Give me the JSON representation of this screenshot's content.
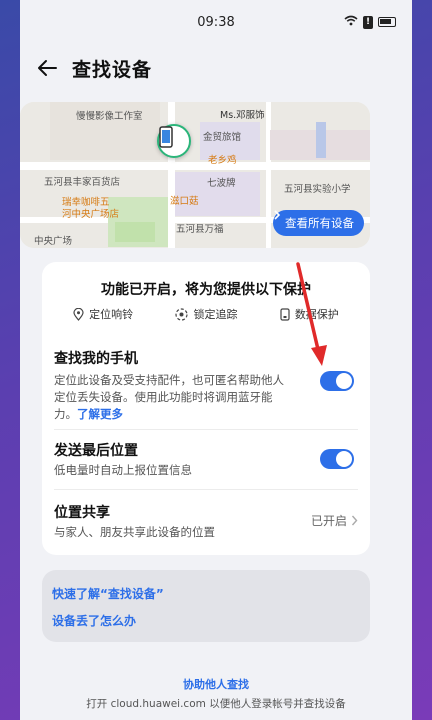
{
  "status_bar": {
    "time": "09:38",
    "alert_glyph": "!"
  },
  "header": {
    "title": "查找设备"
  },
  "map": {
    "labels": {
      "photo_studio": "慢慢影像工作室",
      "ms_deng": "Ms.邓服饰",
      "jinmao_hotel": "金贸旅馆",
      "laoxiangji": "老乡鸡",
      "qibopai": "七波牌",
      "wuhe_fengjia": "五河县丰家百货店",
      "ruixing": "瑞幸咖啡五",
      "ruixing2": "河中央广场店",
      "zizhao": "滋口菇",
      "wuhe_school": "五河县实验小学",
      "wuhe_wanfu": "五河县万福",
      "central_square": "中央广场"
    },
    "view_all_label": "查看所有设备"
  },
  "protection": {
    "title": "功能已开启，将为您提供以下保护",
    "features": [
      "定位响铃",
      "锁定追踪",
      "数据保护"
    ]
  },
  "find_phone": {
    "title": "查找我的手机",
    "desc": "定位此设备及受支持配件，也可匿名帮助他人定位丢失设备。使用此功能时将调用蓝牙能力。",
    "link": "了解更多",
    "enabled": true
  },
  "last_location": {
    "title": "发送最后位置",
    "desc": "低电量时自动上报位置信息",
    "enabled": true
  },
  "location_share": {
    "title": "位置共享",
    "desc": "与家人、朋友共享此设备的位置",
    "status": "已开启"
  },
  "help": {
    "learn": "快速了解“查找设备”",
    "lost": "设备丢了怎么办"
  },
  "footer": {
    "help_others": "协助他人查找",
    "cloud_text": "打开 cloud.huawei.com 以便他人登录帐号并查找设备"
  },
  "colors": {
    "accent": "#2d6fe8",
    "annotation_arrow": "#e02a2a"
  }
}
